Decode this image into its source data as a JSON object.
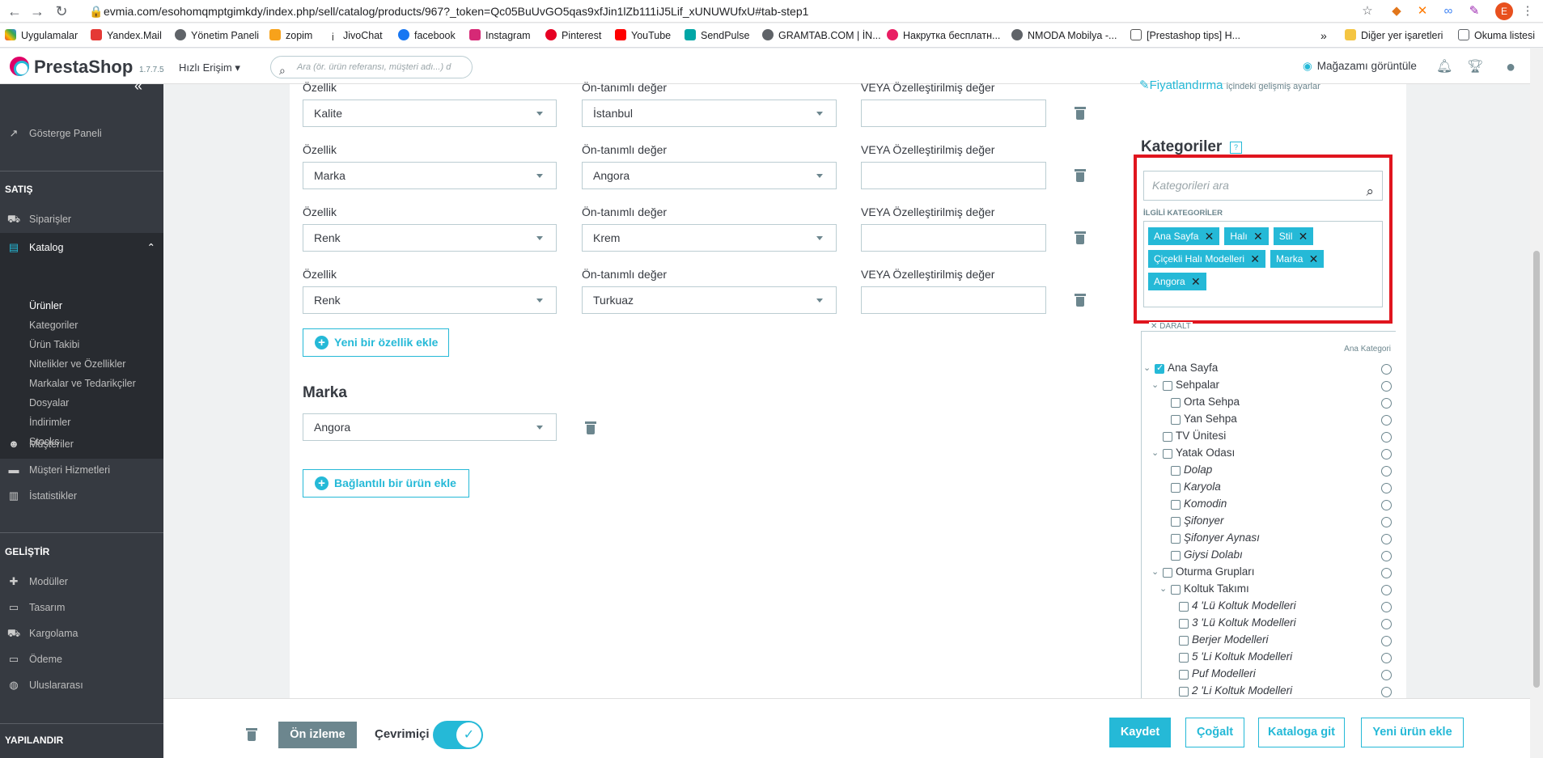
{
  "browser": {
    "url": "evmia.com/esohomqmptgimkdy/index.php/sell/catalog/products/967?_token=Qc05BuUvGO5qas9xfJin1lZb111iJ5Lif_xUNUWUfxU#tab-step1",
    "profile_initial": "E",
    "bookmarks": [
      "Uygulamalar",
      "Yandex.Mail",
      "Yönetim Paneli",
      "zopim",
      "JivoChat",
      "facebook",
      "Instagram",
      "Pinterest",
      "YouTube",
      "SendPulse",
      "GRAMTAB.COM | İN...",
      "Накрутка бесплатн...",
      "NMODA Mobilya -...",
      "[Prestashop tips] H..."
    ],
    "bookmarks_more": "»",
    "other_bookmarks": "Diğer yer işaretleri",
    "reading_list": "Okuma listesi"
  },
  "header": {
    "logo": "PrestaShop",
    "version": "1.7.7.5",
    "quick_access": "Hızlı Erişim",
    "search_placeholder": "Ara (ör. ürün referansı, müşteri adı...) d",
    "view_store": "Mağazamı görüntüle"
  },
  "sidebar": {
    "collapse": "«",
    "dashboard": "Gösterge Paneli",
    "sell_title": "SATIŞ",
    "orders": "Siparişler",
    "catalog": "Katalog",
    "catalog_sub": [
      "Ürünler",
      "Kategoriler",
      "Ürün Takibi",
      "Nitelikler ve Özellikler",
      "Markalar ve Tedarikçiler",
      "Dosyalar",
      "İndirimler",
      "Stocks"
    ],
    "customers": "Müşteriler",
    "customer_service": "Müşteri Hizmetleri",
    "stats": "İstatistikler",
    "improve_title": "GELİŞTİR",
    "modules": "Modüller",
    "design": "Tasarım",
    "shipping": "Kargolama",
    "payment": "Ödeme",
    "international": "Uluslararası",
    "configure_title": "YAPILANDIR"
  },
  "features": {
    "feature_label": "Özellik",
    "default_label": "Ön-tanımlı değer",
    "custom_label": "VEYA Özelleştirilmiş değer",
    "rows": [
      {
        "feature": "Kalite",
        "value": "İstanbul",
        "custom": ""
      },
      {
        "feature": "Marka",
        "value": "Angora",
        "custom": ""
      },
      {
        "feature": "Renk",
        "value": "Krem",
        "custom": ""
      },
      {
        "feature": "Renk",
        "value": "Turkuaz",
        "custom": ""
      }
    ],
    "add_feature": "Yeni bir özellik ekle"
  },
  "brand": {
    "title": "Marka",
    "value": "Angora",
    "add_related": "Bağlantılı bir ürün ekle"
  },
  "categories": {
    "pricing_link": "Fiyatlandırma",
    "pricing_suffix": "içindeki gelişmiş ayarlar",
    "title": "Kategoriler",
    "help": "?",
    "search_placeholder": "Kategorileri ara",
    "related_title": "İLGİLİ KATEGORİLER",
    "tags": [
      "Ana Sayfa",
      "Halı",
      "Stil",
      "Çiçekli Halı Modelleri",
      "Marka",
      "Angora"
    ],
    "collapse": "DARALT",
    "main_category": "Ana Kategori",
    "tree": [
      {
        "label": "Ana Sayfa",
        "checked": true,
        "italic": false
      },
      {
        "label": "Sehpalar",
        "checked": false,
        "italic": false
      },
      {
        "label": "Orta Sehpa",
        "checked": false,
        "italic": false
      },
      {
        "label": "Yan Sehpa",
        "checked": false,
        "italic": false
      },
      {
        "label": "TV Ünitesi",
        "checked": false,
        "italic": false
      },
      {
        "label": "Yatak Odası",
        "checked": false,
        "italic": false
      },
      {
        "label": "Dolap",
        "checked": false,
        "italic": true
      },
      {
        "label": "Karyola",
        "checked": false,
        "italic": true
      },
      {
        "label": "Komodin",
        "checked": false,
        "italic": true
      },
      {
        "label": "Şifonyer",
        "checked": false,
        "italic": true
      },
      {
        "label": "Şifonyer Aynası",
        "checked": false,
        "italic": true
      },
      {
        "label": "Giysi Dolabı",
        "checked": false,
        "italic": true
      },
      {
        "label": "Oturma Grupları",
        "checked": false,
        "italic": false
      },
      {
        "label": "Koltuk Takımı",
        "checked": false,
        "italic": false
      },
      {
        "label": "4 'Lü Koltuk Modelleri",
        "checked": false,
        "italic": true
      },
      {
        "label": "3 'Lü Koltuk Modelleri",
        "checked": false,
        "italic": true
      },
      {
        "label": "Berjer Modelleri",
        "checked": false,
        "italic": true
      },
      {
        "label": "5 'Li Koltuk Modelleri",
        "checked": false,
        "italic": true
      },
      {
        "label": "Puf Modelleri",
        "checked": false,
        "italic": true
      },
      {
        "label": "2 'Li Koltuk Modelleri",
        "checked": false,
        "italic": true
      }
    ]
  },
  "footer": {
    "preview": "Ön izleme",
    "online": "Çevrimiçi",
    "online_on": true,
    "save": "Kaydet",
    "duplicate": "Çoğalt",
    "go_catalog": "Kataloga git",
    "new_product": "Yeni ürün ekle"
  },
  "colors": {
    "accent": "#25b9d7",
    "sidebar": "#363a41",
    "highlight": "#e0151e"
  }
}
